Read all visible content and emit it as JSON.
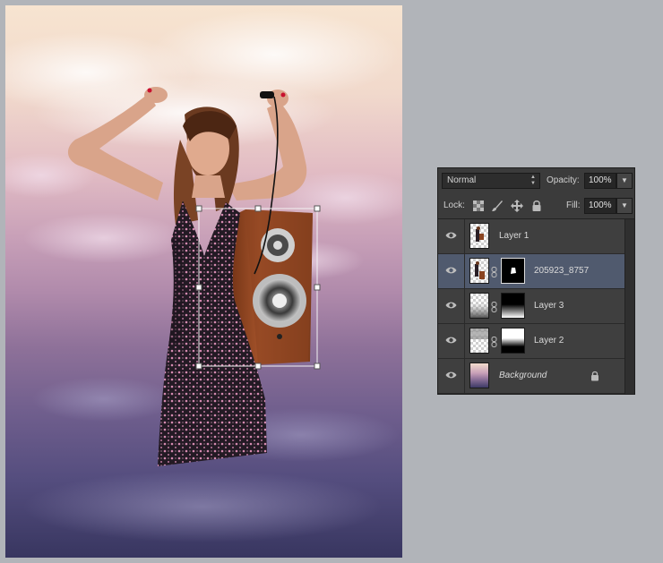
{
  "layers_panel": {
    "blend_mode": "Normal",
    "opacity_label": "Opacity:",
    "opacity_value": "100%",
    "lock_label": "Lock:",
    "fill_label": "Fill:",
    "fill_value": "100%",
    "layers": [
      {
        "name": "Layer 1",
        "visible": true,
        "selected": false,
        "has_mask": false
      },
      {
        "name": "205923_8757",
        "visible": true,
        "selected": true,
        "has_mask": true
      },
      {
        "name": "Layer 3",
        "visible": true,
        "selected": false,
        "has_mask": true
      },
      {
        "name": "Layer 2",
        "visible": true,
        "selected": false,
        "has_mask": true
      },
      {
        "name": "Background",
        "visible": true,
        "selected": false,
        "has_mask": false,
        "locked": true
      }
    ]
  },
  "icons": {
    "eye": "eye-icon",
    "chain": "chain-link-icon",
    "lock": "padlock-icon",
    "lock_transparent": "checkerboard-lock-icon",
    "lock_image": "brush-lock-icon",
    "lock_position": "move-arrows-icon",
    "lock_all": "padlock-icon"
  },
  "colors": {
    "panel_bg": "#535353",
    "row_bg": "#3f3f3f",
    "selected_row": "#505a6e",
    "workspace_bg": "#b1b4b9"
  }
}
